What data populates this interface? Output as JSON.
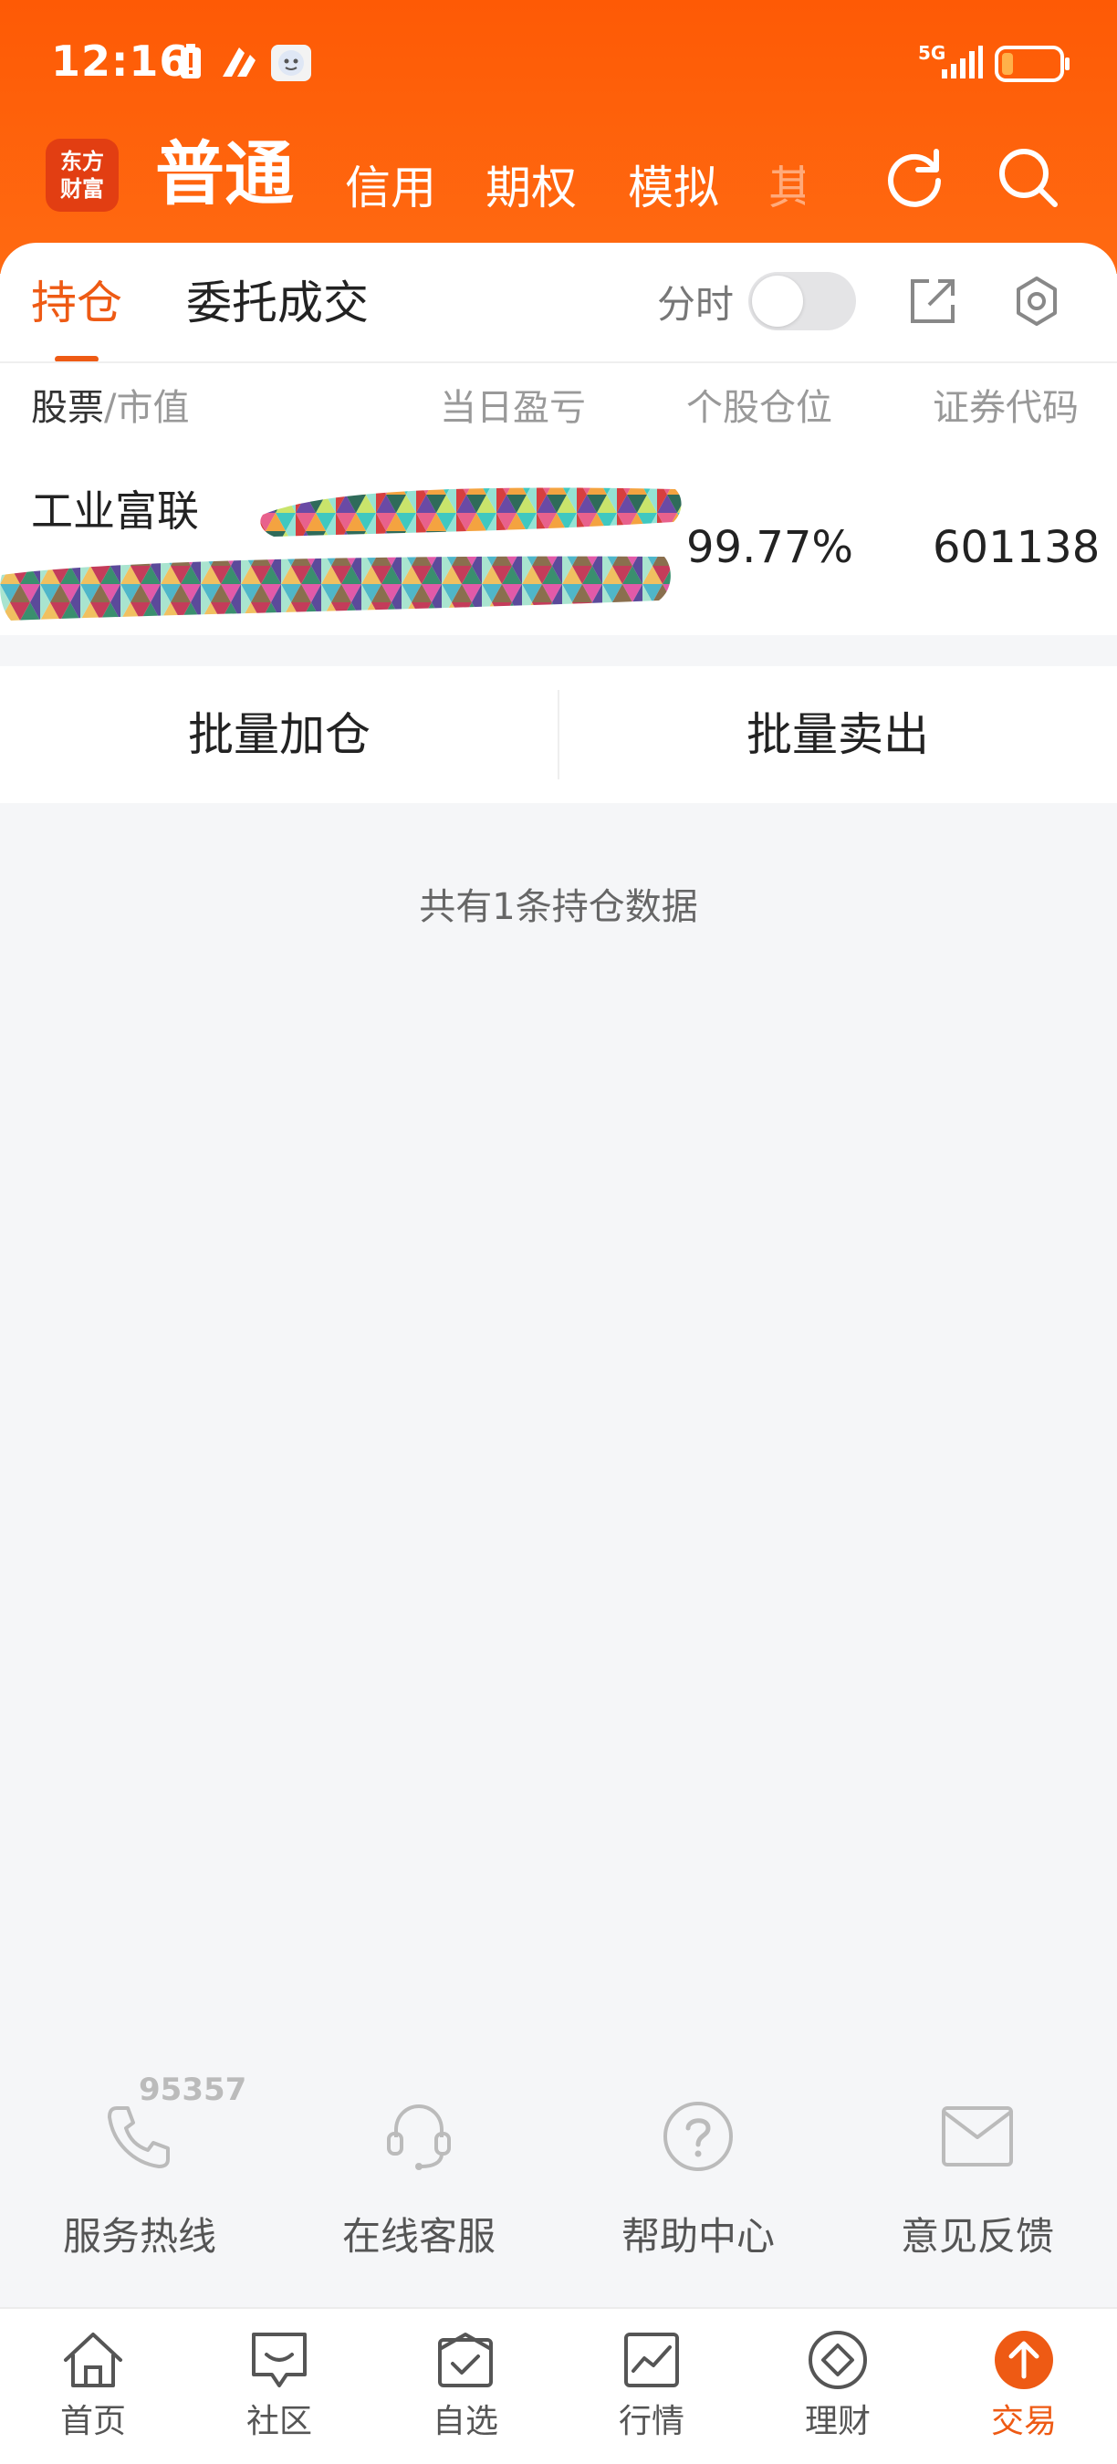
{
  "status_bar": {
    "time": "12:16",
    "network": "5G",
    "battery_level": 0.2
  },
  "header": {
    "logo_line1": "东方",
    "logo_line2": "财富",
    "account_tabs": [
      "普通",
      "信用",
      "期权",
      "模拟",
      "其"
    ],
    "active_account_tab": "普通",
    "brand_color": "#fe5a05"
  },
  "subnav": {
    "tabs": [
      "持仓",
      "委托成交"
    ],
    "active_tab": "持仓",
    "intraday_label": "分时",
    "intraday_on": false
  },
  "table": {
    "headers": {
      "stock": "股票",
      "market_value": "/市值",
      "daily_pnl": "当日盈亏",
      "position_weight": "个股仓位",
      "security_code": "证券代码"
    },
    "rows": [
      {
        "name": "工业富联",
        "weight": "99.77%",
        "code": "601138"
      }
    ]
  },
  "batch": {
    "add_label": "批量加仓",
    "sell_label": "批量卖出"
  },
  "summary": "共有1条持仓数据",
  "services": {
    "hotline_number": "95357",
    "items": [
      {
        "label": "服务热线",
        "icon": "phone-icon"
      },
      {
        "label": "在线客服",
        "icon": "headset-icon"
      },
      {
        "label": "帮助中心",
        "icon": "help-icon"
      },
      {
        "label": "意见反馈",
        "icon": "mail-icon"
      }
    ]
  },
  "bottom_nav": {
    "items": [
      {
        "label": "首页",
        "icon": "home-icon"
      },
      {
        "label": "社区",
        "icon": "chat-icon"
      },
      {
        "label": "自选",
        "icon": "watchlist-icon"
      },
      {
        "label": "行情",
        "icon": "chart-icon"
      },
      {
        "label": "理财",
        "icon": "diamond-icon"
      },
      {
        "label": "交易",
        "icon": "trade-icon"
      }
    ],
    "active": "交易",
    "active_color": "#ee5a14"
  }
}
